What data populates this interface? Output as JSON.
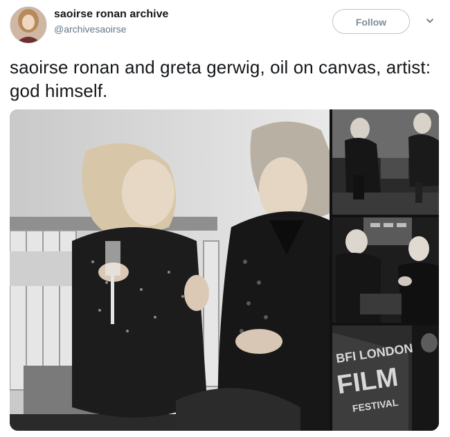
{
  "tweet": {
    "display_name": "saoirse ronan archive",
    "handle": "@archivesaoirse",
    "follow_label": "Follow",
    "text": "saoirse ronan and greta gerwig, oil on canvas, artist: god himself."
  },
  "media": {
    "photo_main_alt": "black and white photo of two women talking",
    "photo_3_sign_line1": "BFI LONDON",
    "photo_3_sign_line2": "FILM",
    "photo_3_sign_line3": "FESTIVAL"
  },
  "icons": {
    "caret": "chevron-down-icon"
  }
}
